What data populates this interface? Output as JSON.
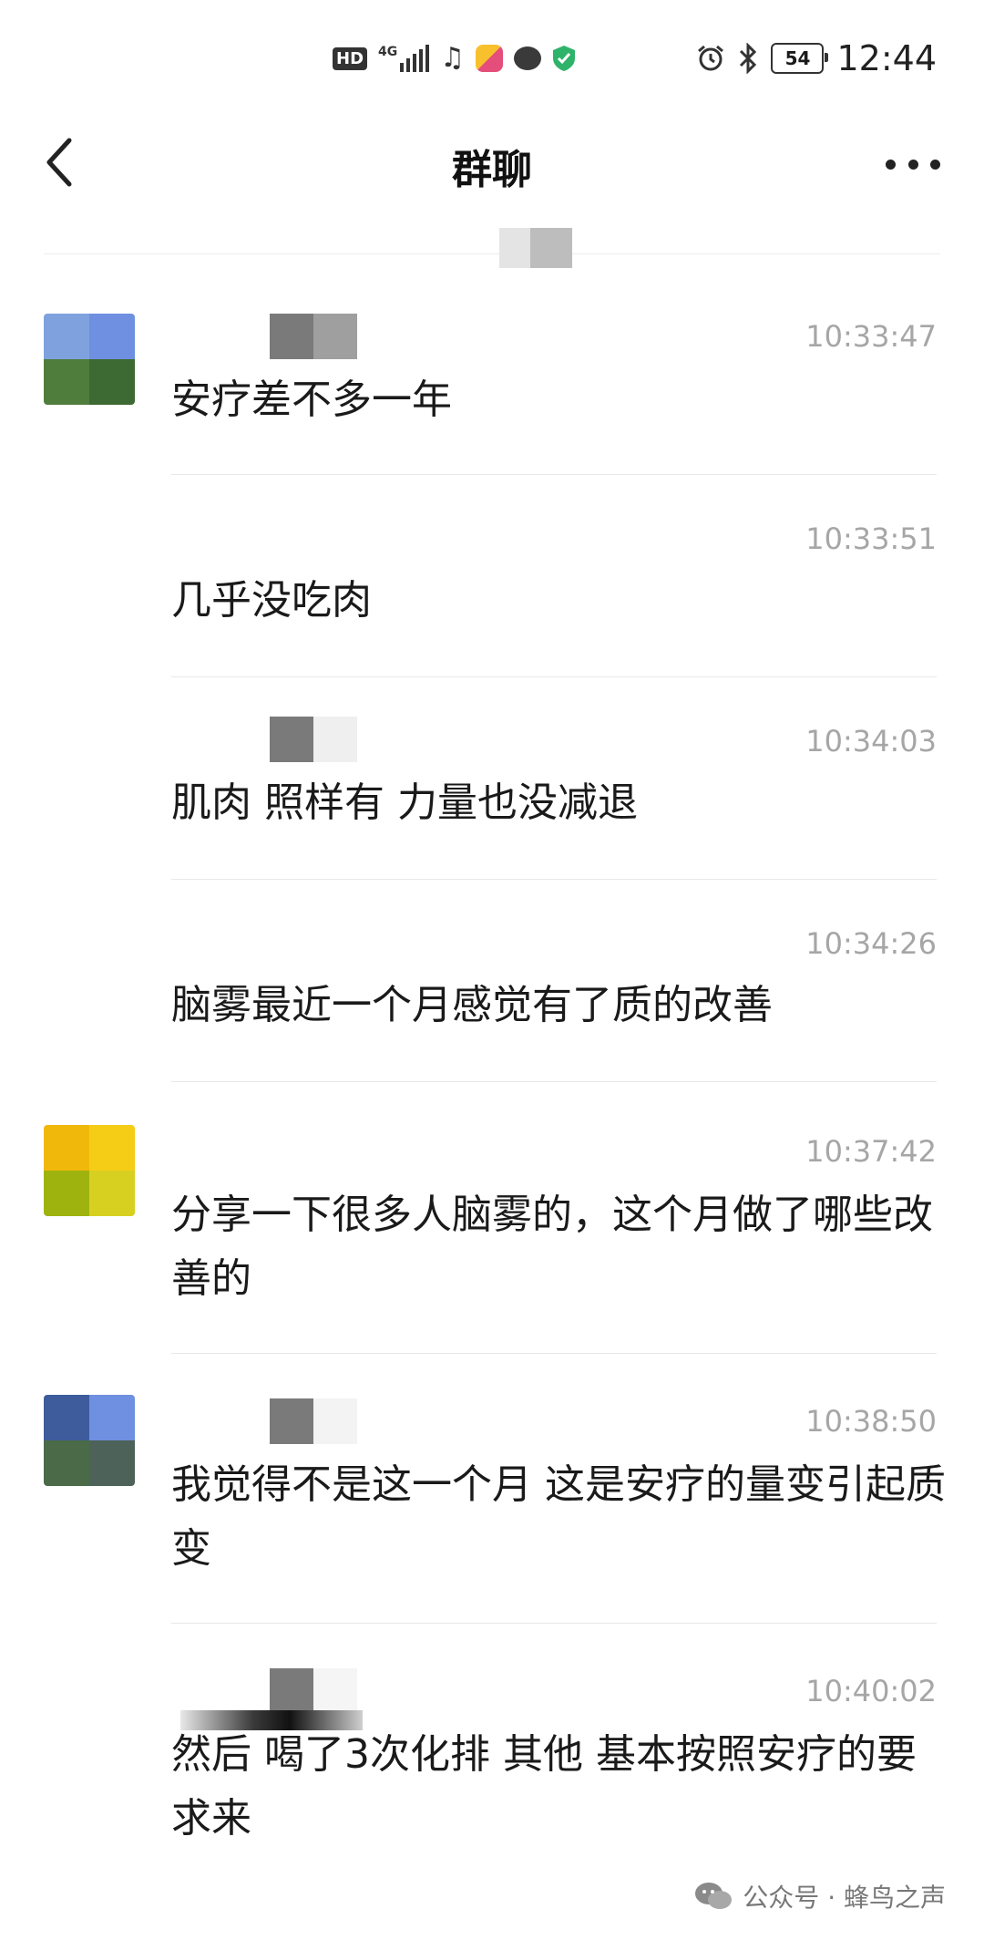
{
  "status_bar": {
    "hd_label": "HD",
    "network_label": "4G",
    "battery": "54",
    "time": "12:44",
    "icons": [
      "signal-icon",
      "music-icon",
      "app-icon",
      "chat-bubble-icon",
      "shield-icon",
      "alarm-icon",
      "bluetooth-icon",
      "battery-icon"
    ]
  },
  "nav": {
    "title": "群聊"
  },
  "messages": [
    {
      "time": "10:33:47",
      "text": "安疗差不多一年"
    },
    {
      "time": "10:33:51",
      "text": "几乎没吃肉"
    },
    {
      "time": "10:34:03",
      "text": "肌肉 照样有 力量也没减退"
    },
    {
      "time": "10:34:26",
      "text": "脑雾最近一个月感觉有了质的改善"
    },
    {
      "time": "10:37:42",
      "text": "分享一下很多人脑雾的，这个月做了哪些改善的"
    },
    {
      "time": "10:38:50",
      "text": "我觉得不是这一个月 这是安疗的量变引起质变"
    },
    {
      "time": "10:40:02",
      "text": "然后 喝了3次化排 其他 基本按照安疗的要求来"
    }
  ],
  "watermark": {
    "text": "公众号 · 蜂鸟之声"
  },
  "colors": {
    "timestamp": "#a6a6a6",
    "divider": "#e8e8e8",
    "text": "#1a1a1a"
  }
}
